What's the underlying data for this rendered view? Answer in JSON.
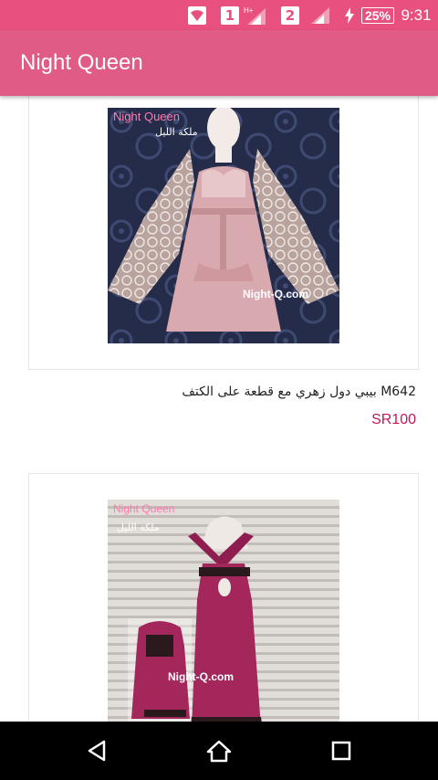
{
  "status_bar": {
    "sim1": "1",
    "sim2": "2",
    "network1": "H+",
    "battery": "25%",
    "time": "9:31",
    "icons": [
      "wifi-icon",
      "sim1-signal-icon",
      "sim2-signal-icon",
      "charging-icon",
      "battery-icon"
    ]
  },
  "app_bar": {
    "title": "Night Queen",
    "color": "#e05c87"
  },
  "products": [
    {
      "image_logo": "Night Queen",
      "image_logo_ar": "ملكة الليل",
      "image_watermark": "Night-Q.com",
      "name": "M642 بيبي دول زهري مع قطعة على الكتف",
      "price": "SR100"
    },
    {
      "image_logo": "Night Queen",
      "image_logo_ar": "ملكة الليل",
      "image_watermark": "Night-Q.com"
    }
  ],
  "nav_bar": {
    "back": "back-icon",
    "home": "home-icon",
    "recents": "recents-icon"
  },
  "colors": {
    "status_bar": "#e8517f",
    "price": "#c2185b"
  }
}
